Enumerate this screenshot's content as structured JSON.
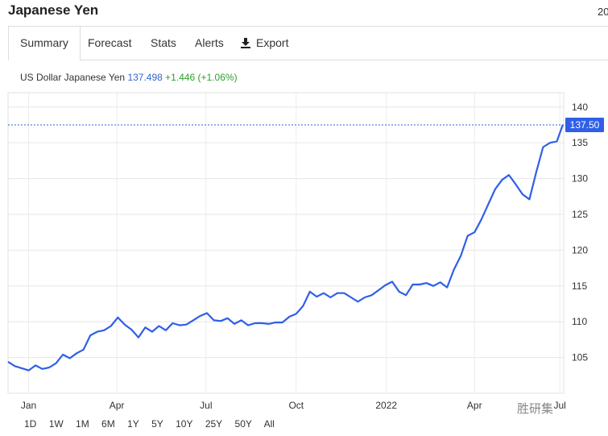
{
  "header": {
    "title": "Japanese Yen",
    "date_fragment": "20"
  },
  "tabs": [
    {
      "label": "Summary",
      "active": true
    },
    {
      "label": "Forecast"
    },
    {
      "label": "Stats"
    },
    {
      "label": "Alerts"
    },
    {
      "label": "Export",
      "icon": "download-icon"
    }
  ],
  "quote": {
    "name": "US Dollar Japanese Yen",
    "price": "137.498",
    "change": "+1.446 (+1.06%)"
  },
  "colors": {
    "line": "#2f5fe8",
    "price": "#3366cc",
    "change": "#2ca02c",
    "current_badge": "#2f5fe8"
  },
  "ranges": [
    "1D",
    "1W",
    "1M",
    "6M",
    "1Y",
    "5Y",
    "10Y",
    "25Y",
    "50Y",
    "All"
  ],
  "watermark": "胜研集",
  "chart_data": {
    "type": "line",
    "title": "",
    "xlabel": "",
    "ylabel": "",
    "ylim": [
      100,
      142
    ],
    "xlim": [
      "2020-12-11",
      "2022-07-01"
    ],
    "grid": true,
    "current_value_label": "137.50",
    "y_ticks": [
      105,
      110,
      115,
      120,
      125,
      130,
      135,
      140
    ],
    "x_ticks": [
      {
        "date": "2021-01-01",
        "label": "Jan"
      },
      {
        "date": "2021-04-01",
        "label": "Apr"
      },
      {
        "date": "2021-07-01",
        "label": "Jul"
      },
      {
        "date": "2021-10-01",
        "label": "Oct"
      },
      {
        "date": "2022-01-01",
        "label": "2022"
      },
      {
        "date": "2022-04-01",
        "label": "Apr"
      },
      {
        "date": "2022-06-27",
        "label": "Jul"
      }
    ],
    "series": [
      {
        "points": [
          [
            "2020-12-11",
            104.4
          ],
          [
            "2020-12-18",
            103.8
          ],
          [
            "2020-12-25",
            103.5
          ],
          [
            "2021-01-01",
            103.2
          ],
          [
            "2021-01-08",
            103.9
          ],
          [
            "2021-01-15",
            103.4
          ],
          [
            "2021-01-22",
            103.6
          ],
          [
            "2021-01-29",
            104.2
          ],
          [
            "2021-02-05",
            105.4
          ],
          [
            "2021-02-12",
            104.9
          ],
          [
            "2021-02-19",
            105.6
          ],
          [
            "2021-02-26",
            106.1
          ],
          [
            "2021-03-05",
            108.1
          ],
          [
            "2021-03-12",
            108.6
          ],
          [
            "2021-03-19",
            108.8
          ],
          [
            "2021-03-26",
            109.4
          ],
          [
            "2021-04-02",
            110.6
          ],
          [
            "2021-04-09",
            109.6
          ],
          [
            "2021-04-16",
            108.9
          ],
          [
            "2021-04-23",
            107.8
          ],
          [
            "2021-04-30",
            109.2
          ],
          [
            "2021-05-07",
            108.6
          ],
          [
            "2021-05-14",
            109.4
          ],
          [
            "2021-05-21",
            108.8
          ],
          [
            "2021-05-28",
            109.8
          ],
          [
            "2021-06-04",
            109.5
          ],
          [
            "2021-06-11",
            109.6
          ],
          [
            "2021-06-18",
            110.2
          ],
          [
            "2021-06-25",
            110.8
          ],
          [
            "2021-07-02",
            111.2
          ],
          [
            "2021-07-09",
            110.2
          ],
          [
            "2021-07-16",
            110.1
          ],
          [
            "2021-07-23",
            110.5
          ],
          [
            "2021-07-30",
            109.7
          ],
          [
            "2021-08-06",
            110.2
          ],
          [
            "2021-08-13",
            109.5
          ],
          [
            "2021-08-20",
            109.8
          ],
          [
            "2021-08-27",
            109.8
          ],
          [
            "2021-09-03",
            109.7
          ],
          [
            "2021-09-10",
            109.9
          ],
          [
            "2021-09-17",
            109.9
          ],
          [
            "2021-09-24",
            110.7
          ],
          [
            "2021-10-01",
            111.1
          ],
          [
            "2021-10-08",
            112.2
          ],
          [
            "2021-10-15",
            114.2
          ],
          [
            "2021-10-22",
            113.5
          ],
          [
            "2021-10-29",
            114.0
          ],
          [
            "2021-11-05",
            113.4
          ],
          [
            "2021-11-12",
            114.0
          ],
          [
            "2021-11-19",
            114.0
          ],
          [
            "2021-11-26",
            113.4
          ],
          [
            "2021-12-03",
            112.8
          ],
          [
            "2021-12-10",
            113.4
          ],
          [
            "2021-12-17",
            113.7
          ],
          [
            "2021-12-24",
            114.4
          ],
          [
            "2021-12-31",
            115.1
          ],
          [
            "2022-01-07",
            115.6
          ],
          [
            "2022-01-14",
            114.2
          ],
          [
            "2022-01-21",
            113.7
          ],
          [
            "2022-01-28",
            115.2
          ],
          [
            "2022-02-04",
            115.2
          ],
          [
            "2022-02-11",
            115.4
          ],
          [
            "2022-02-18",
            115.0
          ],
          [
            "2022-02-25",
            115.5
          ],
          [
            "2022-03-04",
            114.8
          ],
          [
            "2022-03-11",
            117.3
          ],
          [
            "2022-03-18",
            119.2
          ],
          [
            "2022-03-25",
            122.0
          ],
          [
            "2022-04-01",
            122.5
          ],
          [
            "2022-04-08",
            124.3
          ],
          [
            "2022-04-15",
            126.4
          ],
          [
            "2022-04-22",
            128.5
          ],
          [
            "2022-04-29",
            129.8
          ],
          [
            "2022-05-06",
            130.5
          ],
          [
            "2022-05-13",
            129.2
          ],
          [
            "2022-05-20",
            127.8
          ],
          [
            "2022-05-27",
            127.1
          ],
          [
            "2022-06-03",
            130.9
          ],
          [
            "2022-06-10",
            134.4
          ],
          [
            "2022-06-17",
            135.0
          ],
          [
            "2022-06-24",
            135.2
          ],
          [
            "2022-06-30",
            137.5
          ]
        ]
      }
    ]
  }
}
